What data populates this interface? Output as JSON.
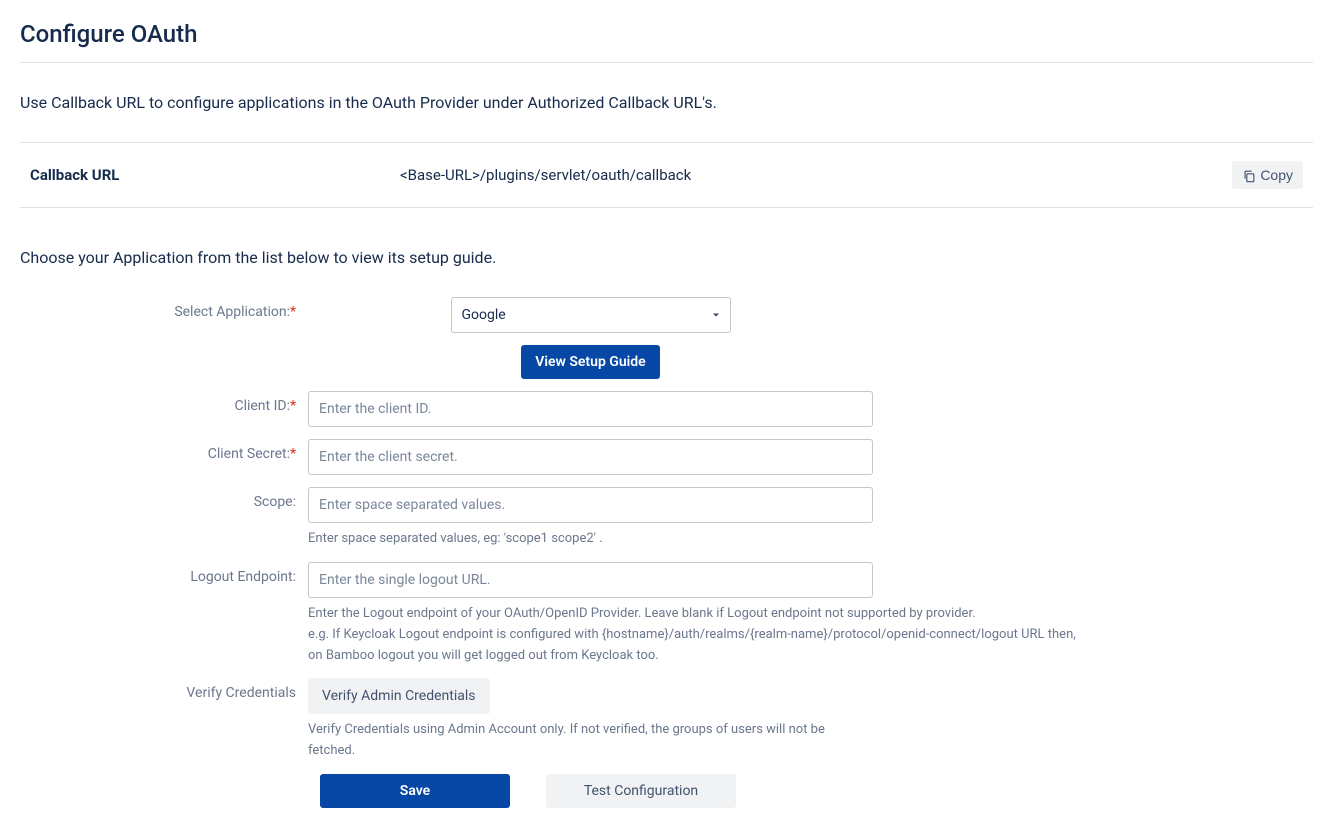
{
  "page_title": "Configure OAuth",
  "intro_text": "Use Callback URL to configure applications in the OAuth Provider under Authorized Callback URL's.",
  "callback": {
    "label": "Callback URL",
    "value": "<Base-URL>/plugins/servlet/oauth/callback",
    "copy_label": "Copy"
  },
  "section_text": "Choose your Application from the list below to view its setup guide.",
  "form": {
    "select_application": {
      "label": "Select Application:",
      "value": "Google",
      "setup_guide_label": "View Setup Guide"
    },
    "client_id": {
      "label": "Client ID:",
      "placeholder": "Enter the client ID."
    },
    "client_secret": {
      "label": "Client Secret:",
      "placeholder": "Enter the client secret."
    },
    "scope": {
      "label": "Scope:",
      "placeholder": "Enter space separated values.",
      "hint": "Enter space separated values, eg: 'scope1 scope2' ."
    },
    "logout_endpoint": {
      "label": "Logout Endpoint:",
      "placeholder": "Enter the single logout URL.",
      "hint": "Enter the Logout endpoint of your OAuth/OpenID Provider. Leave blank if Logout endpoint not supported by provider.\ne.g. If Keycloak Logout endpoint is configured with {hostname}/auth/realms/{realm-name}/protocol/openid-connect/logout URL then, on Bamboo logout you will get logged out from Keycloak too."
    },
    "verify_credentials": {
      "label": "Verify Credentials",
      "button_label": "Verify Admin Credentials",
      "hint": "Verify Credentials using Admin Account only. If not verified, the groups of users will not be fetched."
    }
  },
  "actions": {
    "save_label": "Save",
    "test_label": "Test Configuration"
  }
}
